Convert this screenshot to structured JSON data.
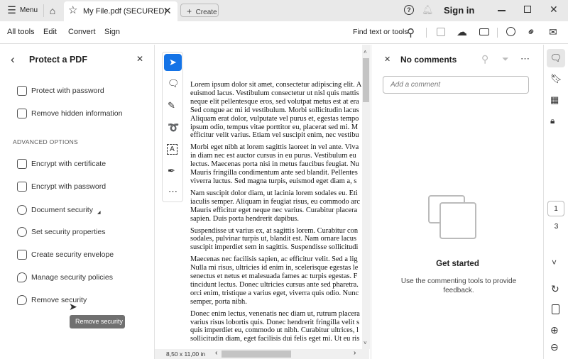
{
  "titlebar": {
    "menu": "Menu",
    "tab_title": "My File.pdf (SECURED)",
    "create": "Create",
    "sign_in": "Sign in"
  },
  "toolbar": {
    "items": [
      "All tools",
      "Edit",
      "Convert",
      "Sign"
    ],
    "find": "Find text or tools"
  },
  "panel": {
    "title": "Protect a PDF",
    "items": [
      "Protect with password",
      "Remove hidden information"
    ],
    "section": "ADVANCED OPTIONS",
    "advanced": [
      "Encrypt with certificate",
      "Encrypt with password",
      "Document security",
      "Set security properties",
      "Create security envelope",
      "Manage security policies",
      "Remove security"
    ],
    "tooltip": "Remove security"
  },
  "doc": {
    "paragraphs": [
      [
        "Lorem ipsum dolor sit amet, consectetur adipiscing elit. A",
        "euismod lacus. Vestibulum consectetur ut nisl quis mattis",
        "neque elit pellentesque eros, sed volutpat metus est at era",
        "Sed congue ac mi id vestibulum. Morbi sollicitudin lacus",
        "Aliquam erat dolor, vulputate vel purus et, egestas tempo",
        "ipsum odio, tempus vitae porttitor eu, placerat sed mi. M",
        "efficitur velit varius. Etiam vel suscipit enim, nec vestibu"
      ],
      [
        "Morbi eget nibh at lorem sagittis laoreet in vel ante. Viva",
        "in diam nec est auctor cursus in eu purus. Vestibulum eu",
        "lectus. Maecenas porta nisi in metus faucibus feugiat. Nu",
        "Mauris fringilla condimentum ante sed blandit. Pellentes",
        "viverra luctus. Sed magna turpis, euismod eget diam a, s"
      ],
      [
        "Nam suscipit dolor diam, ut lacinia lorem sodales eu. Eti",
        "iaculis semper. Aliquam in feugiat risus, eu commodo arc",
        "Mauris efficitur eget neque nec varius. Curabitur placera",
        "sapien. Duis porta hendrerit dapibus."
      ],
      [
        "Suspendisse ut varius ex, at sagittis lorem. Curabitur con",
        "sodales, pulvinar turpis ut, blandit est. Nam ornare lacus",
        "suscipit imperdiet sem in sagittis. Suspendisse sollicitudi"
      ],
      [
        "Maecenas nec facilisis sapien, ac efficitur velit. Sed a lig",
        "Nulla mi risus, ultricies id enim in, scelerisque egestas le",
        "senectus et netus et malesuada fames ac turpis egestas. F",
        "tincidunt lectus. Donec ultricies cursus ante sed pharetra.",
        "orci enim, tristique a varius eget, viverra quis odio. Nunc",
        "semper, porta nibh."
      ],
      [
        "Donec enim lectus, venenatis nec diam ut, rutrum placera",
        "varius risus lobortis quis. Donec hendrerit fringilla velit s",
        "quis imperdiet eu, commodo ut nibh. Curabitur ultrices, l",
        "sollicitudin diam, eget facilisis dui felis eget mi. Ut eu ris"
      ]
    ],
    "page_size": "8,50 x 11,00 in"
  },
  "comments": {
    "title": "No comments",
    "placeholder": "Add a comment",
    "get_started": "Get started",
    "hint": "Use the commenting tools to provide feedback."
  },
  "pages": {
    "current": "1",
    "total": "3"
  }
}
